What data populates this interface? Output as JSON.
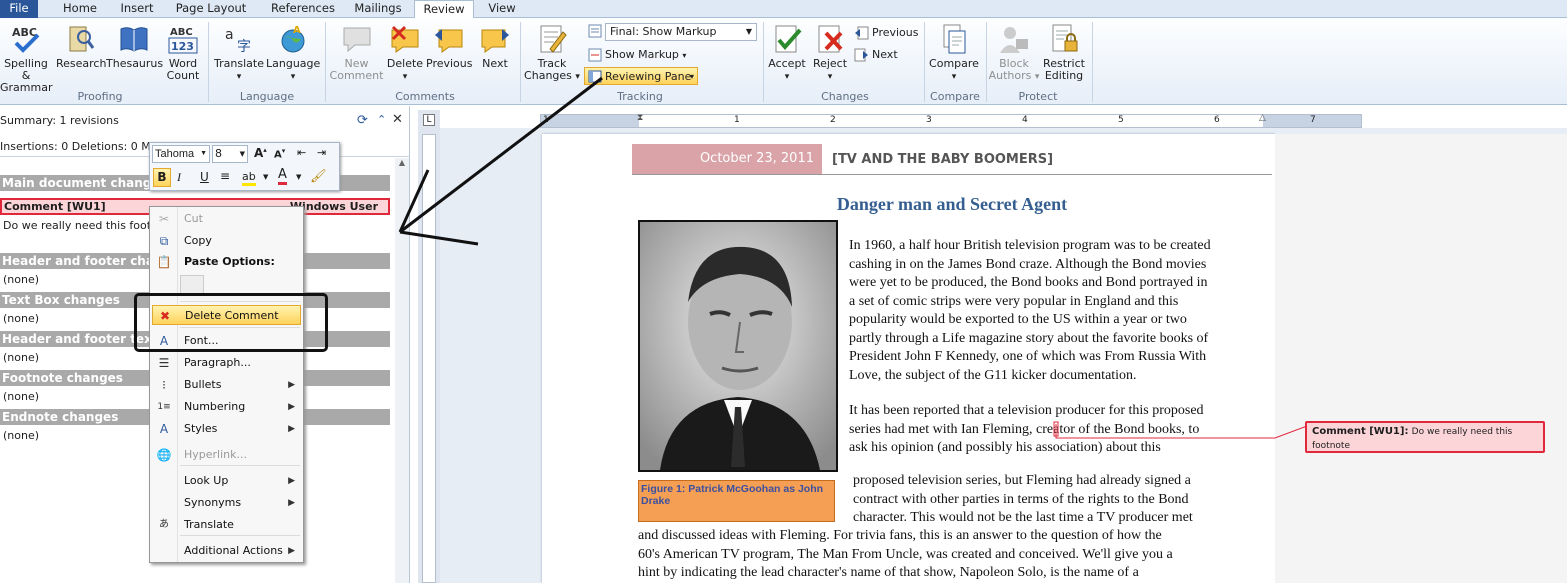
{
  "tabs": [
    "File",
    "Home",
    "Insert",
    "Page Layout",
    "References",
    "Mailings",
    "Review",
    "View"
  ],
  "ribbon": {
    "spelling": "Spelling &",
    "grammar": "Grammar",
    "research": "Research",
    "thesaurus": "Thesaurus",
    "word": "Word",
    "count": "Count",
    "proofing": "Proofing",
    "translate": "Translate",
    "language_btn": "Language",
    "language": "Language",
    "new": "New",
    "comment": "Comment",
    "delete": "Delete",
    "previous": "Previous",
    "next": "Next",
    "comments": "Comments",
    "track": "Track",
    "changes_btn": "Changes",
    "display_value": "Final: Show Markup",
    "show_markup": "Show Markup",
    "reviewing_pane": "Reviewing Pane",
    "tracking": "Tracking",
    "accept": "Accept",
    "reject": "Reject",
    "prev_small": "Previous",
    "next_small": "Next",
    "changes": "Changes",
    "compare_btn": "Compare",
    "compare": "Compare",
    "block": "Block",
    "authors": "Authors",
    "restrict": "Restrict",
    "editing": "Editing",
    "protect": "Protect"
  },
  "pane": {
    "summary": "Summary: 1 revisions",
    "counts": "Insertions: 0  Deletions: 0  Mov",
    "main": "Main document changes",
    "comment_label": "Comment [WU1]",
    "comment_author": "Windows User",
    "comment_text": "Do we really need this footn",
    "header": "Header and footer changes",
    "textbox": "Text Box changes",
    "header_tb": "Header and footer textbox changes",
    "footnote": "Footnote changes",
    "endnote": "Endnote changes",
    "none": "(none)"
  },
  "mini": {
    "font": "Tahoma",
    "size": "8"
  },
  "menu": {
    "cut": "Cut",
    "copy": "Copy",
    "paste_options": "Paste Options:",
    "delete_comment": "Delete Comment",
    "font": "Font...",
    "paragraph": "Paragraph...",
    "bullets": "Bullets",
    "numbering": "Numbering",
    "styles": "Styles",
    "hyperlink": "Hyperlink...",
    "lookup": "Look Up",
    "synonyms": "Synonyms",
    "translate": "Translate",
    "additional": "Additional Actions"
  },
  "ruler_numbers": [
    "1",
    "1",
    "2",
    "3",
    "4",
    "5",
    "6",
    "7"
  ],
  "doc": {
    "date": "October 23, 2011",
    "header": "[TV AND THE BABY BOOMERS]",
    "title": "Danger man and Secret Agent",
    "p1": [
      "In 1960, a half hour British television program was to be created",
      "cashing in on the James Bond craze. Although the Bond movies",
      "were yet to be produced, the Bond books and Bond portrayed in",
      "a set of comic strips were very popular in England and this",
      "popularity would be exported to the US within a year or two",
      "partly through a Life magazine story about the favorite books of",
      "President John F Kennedy, one of which was From Russia With",
      "Love, the subject of the G11 kicker documentation."
    ],
    "p2": [
      "It has been reported that a television producer for this proposed",
      "series had met with Ian Fleming, creator of the Bond books, to",
      "ask his opinion (and possibly his association) about this"
    ],
    "p3": [
      "proposed television series, but Fleming had already signed a",
      "contract with other parties in terms of the rights to the Bond",
      "character. This would not be the last time a TV producer met"
    ],
    "p4": [
      "and discussed ideas with Fleming. For trivia fans, this is an answer to the question of how the",
      "60's American TV program, The Man From Uncle, was created and conceived. We'll give you a",
      "hint by indicating the lead character's name of that show, Napoleon Solo, is the name of a"
    ],
    "caption": "Figure 1: Patrick McGoohan as John Drake",
    "balloon_label": "Comment [WU1]:",
    "balloon_text": "Do we really need this footnote"
  },
  "colors": {
    "accent": "#2b579a",
    "comment_red": "#e0283c",
    "date_band": "#d9a3a8",
    "title_blue": "#365f91"
  }
}
